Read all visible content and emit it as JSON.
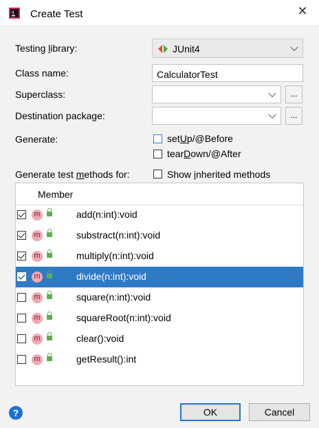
{
  "dialog": {
    "title": "Create Test",
    "close_glyph": "✕"
  },
  "form": {
    "testing_library_label_pre": "Testing ",
    "testing_library_label_u": "l",
    "testing_library_label_post": "ibrary:",
    "testing_library_value": "JUnit4",
    "class_name_label": "Class name:",
    "class_name_value": "CalculatorTest",
    "superclass_label": "Superclass:",
    "superclass_value": "",
    "destination_label": "Destination package:",
    "destination_value": "",
    "browse_label": "...",
    "generate_label": "Generate:",
    "setup_pre": "set",
    "setup_u": "U",
    "setup_post": "p/@Before",
    "setup_checked": false,
    "teardown_pre": "tear",
    "teardown_u": "D",
    "teardown_post": "own/@After",
    "teardown_checked": false,
    "methods_label_pre": "Generate test ",
    "methods_label_u": "m",
    "methods_label_post": "ethods for:",
    "show_inherited_pre": "Show ",
    "show_inherited_u": "i",
    "show_inherited_post": "nherited methods",
    "show_inherited_checked": false
  },
  "table": {
    "header": "Member",
    "member_icon_letter": "m",
    "rows": [
      {
        "name": "add(n:int):void",
        "checked": true,
        "selected": false
      },
      {
        "name": "substract(n:int):void",
        "checked": true,
        "selected": false
      },
      {
        "name": "multiply(n:int):void",
        "checked": true,
        "selected": false
      },
      {
        "name": "divide(n:int):void",
        "checked": true,
        "selected": true
      },
      {
        "name": "square(n:int):void",
        "checked": false,
        "selected": false
      },
      {
        "name": "squareRoot(n:int):void",
        "checked": false,
        "selected": false
      },
      {
        "name": "clear():void",
        "checked": false,
        "selected": false
      },
      {
        "name": "getResult():int",
        "checked": false,
        "selected": false
      }
    ]
  },
  "footer": {
    "help_glyph": "?",
    "ok_label": "OK",
    "cancel_label": "Cancel"
  },
  "colors": {
    "selection": "#2f7ac4",
    "accent_button_border": "#2b73c9",
    "member_icon": "#f4a8b4",
    "lock_icon": "#5fae4f"
  }
}
